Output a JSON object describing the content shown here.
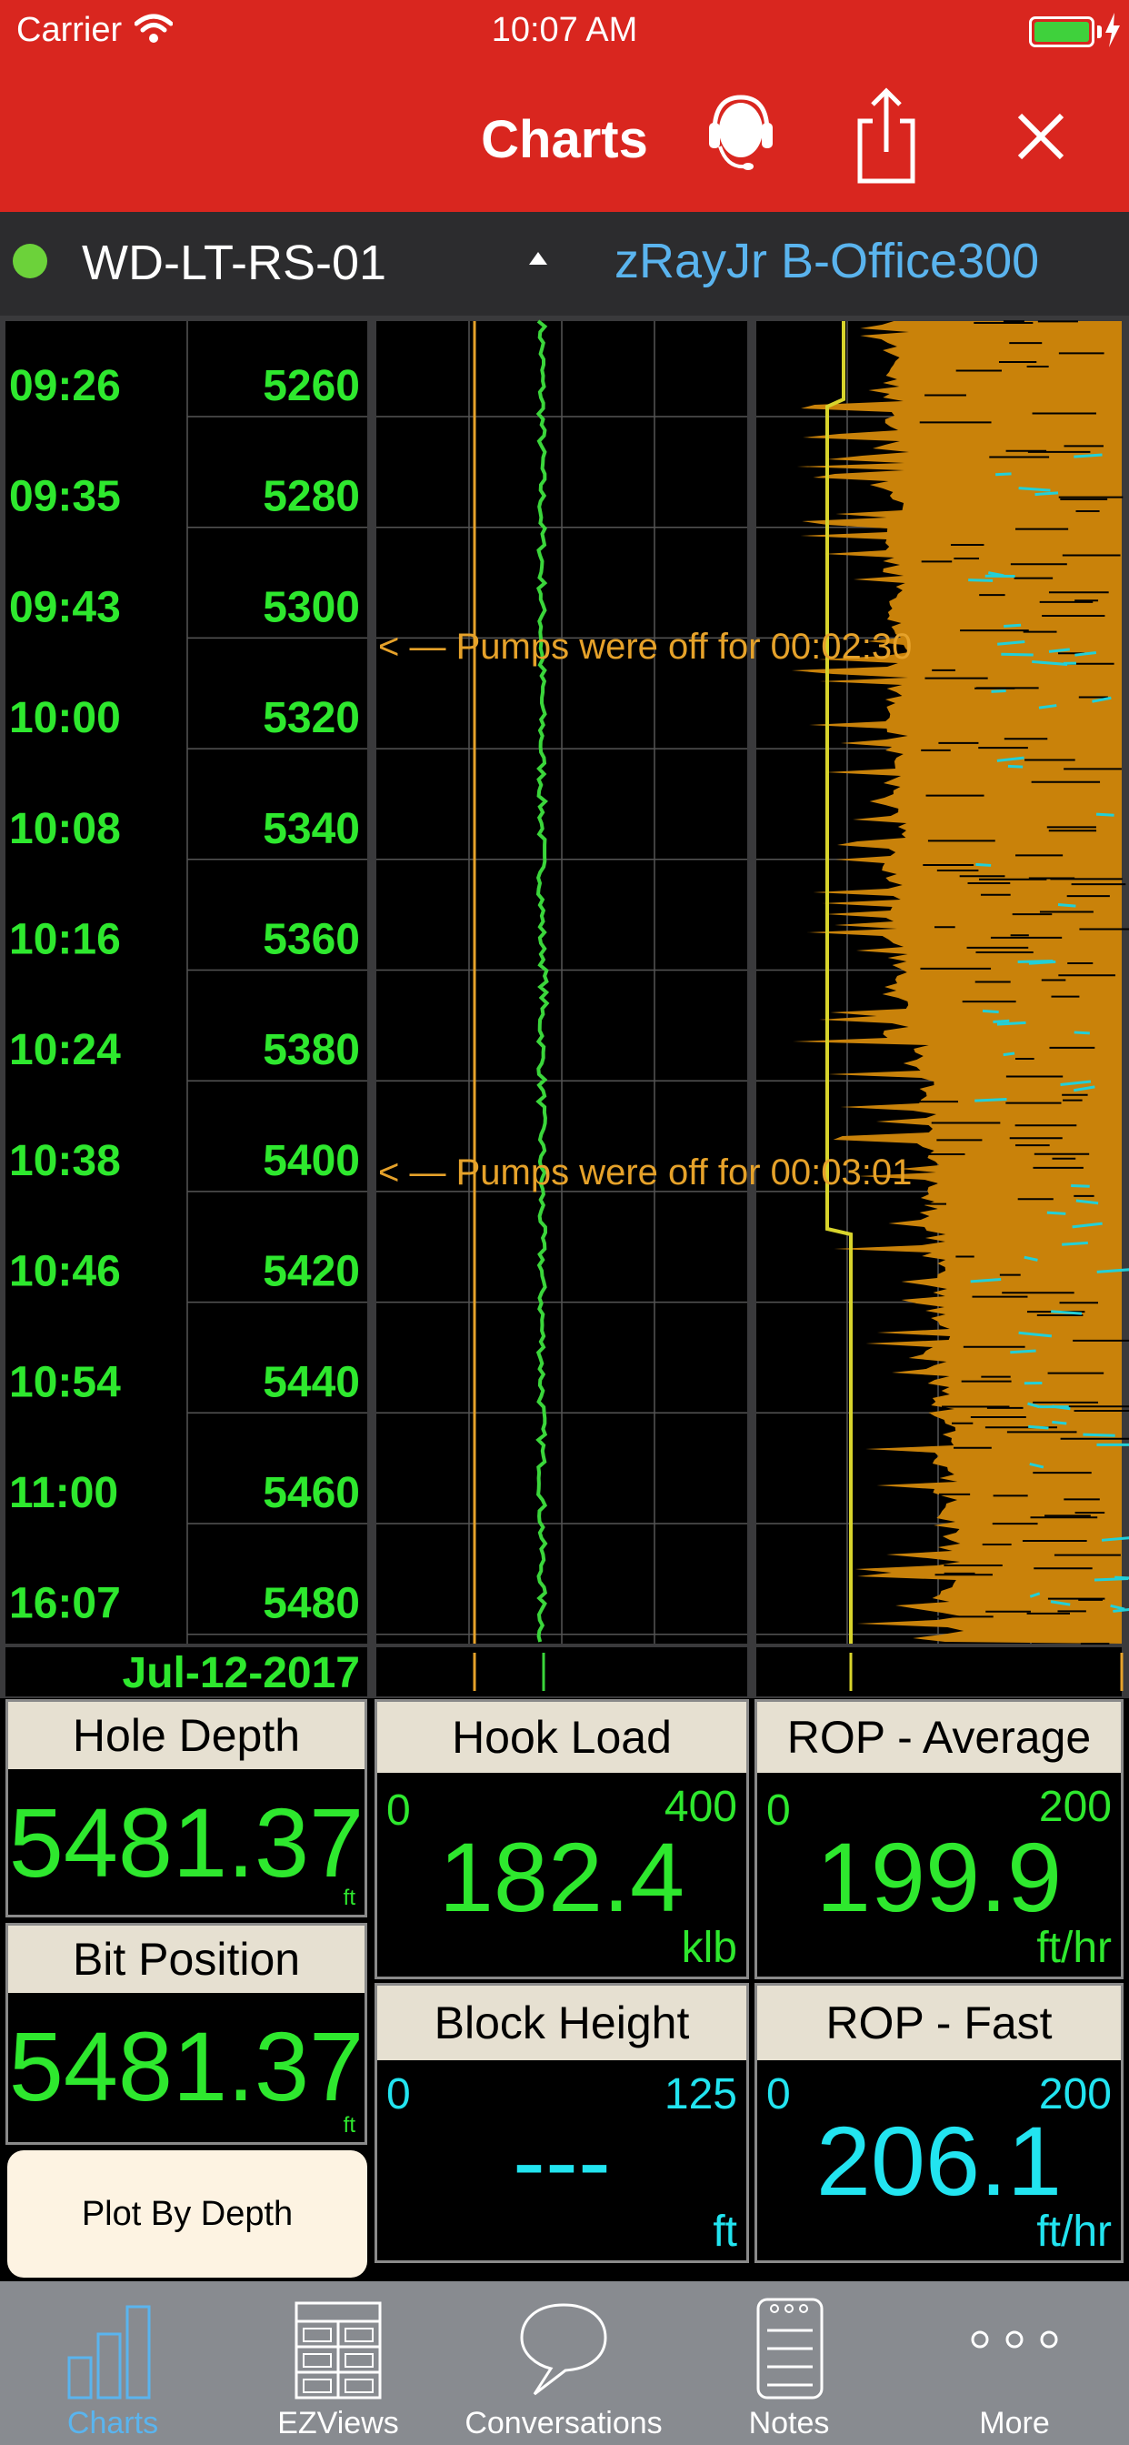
{
  "status_bar": {
    "carrier": "Carrier",
    "time": "10:07 AM"
  },
  "header": {
    "title": "Charts"
  },
  "well_bar": {
    "well": "WD-LT-RS-01",
    "rig": "zRayJr B-Office300"
  },
  "chart": {
    "rows": [
      {
        "time": "09:26",
        "depth": "5260"
      },
      {
        "time": "09:35",
        "depth": "5280"
      },
      {
        "time": "09:43",
        "depth": "5300"
      },
      {
        "time": "10:00",
        "depth": "5320"
      },
      {
        "time": "10:08",
        "depth": "5340"
      },
      {
        "time": "10:16",
        "depth": "5360"
      },
      {
        "time": "10:24",
        "depth": "5380"
      },
      {
        "time": "10:38",
        "depth": "5400"
      },
      {
        "time": "10:46",
        "depth": "5420"
      },
      {
        "time": "10:54",
        "depth": "5440"
      },
      {
        "time": "11:00",
        "depth": "5460"
      },
      {
        "time": "16:07",
        "depth": "5480"
      }
    ],
    "date": "Jul-12-2017",
    "annotations": [
      {
        "text": "Pumps were off for 00:02:30",
        "depth": 5305
      },
      {
        "text": "Pumps were off for 00:03:01",
        "depth": 5400
      }
    ],
    "colors": {
      "label": "#2ee82e",
      "hookload_trace": "#3bd63b",
      "orange_trace": "#e6a22a",
      "yellow_trace": "#d8d42c",
      "cyan_trace": "#22d0d8"
    }
  },
  "readouts": {
    "hole_depth": {
      "title": "Hole Depth",
      "value": "5481.37",
      "unit": "ft"
    },
    "bit_position": {
      "title": "Bit Position",
      "value": "5481.37",
      "unit": "ft"
    },
    "hook_load": {
      "title": "Hook Load",
      "min": "0",
      "max": "400",
      "value": "182.4",
      "unit": "klb"
    },
    "rop_average": {
      "title": "ROP - Average",
      "min": "0",
      "max": "200",
      "value": "199.9",
      "unit": "ft/hr"
    },
    "block_height": {
      "title": "Block Height",
      "min": "0",
      "max": "125",
      "value": "---",
      "unit": "ft"
    },
    "rop_fast": {
      "title": "ROP - Fast",
      "min": "0",
      "max": "200",
      "value": "206.1",
      "unit": "ft/hr"
    }
  },
  "plot_button": {
    "label": "Plot By Depth"
  },
  "tabs": [
    {
      "id": "charts",
      "label": "Charts"
    },
    {
      "id": "ezviews",
      "label": "EZViews"
    },
    {
      "id": "conversations",
      "label": "Conversations"
    },
    {
      "id": "notes",
      "label": "Notes"
    },
    {
      "id": "more",
      "label": "More"
    }
  ]
}
